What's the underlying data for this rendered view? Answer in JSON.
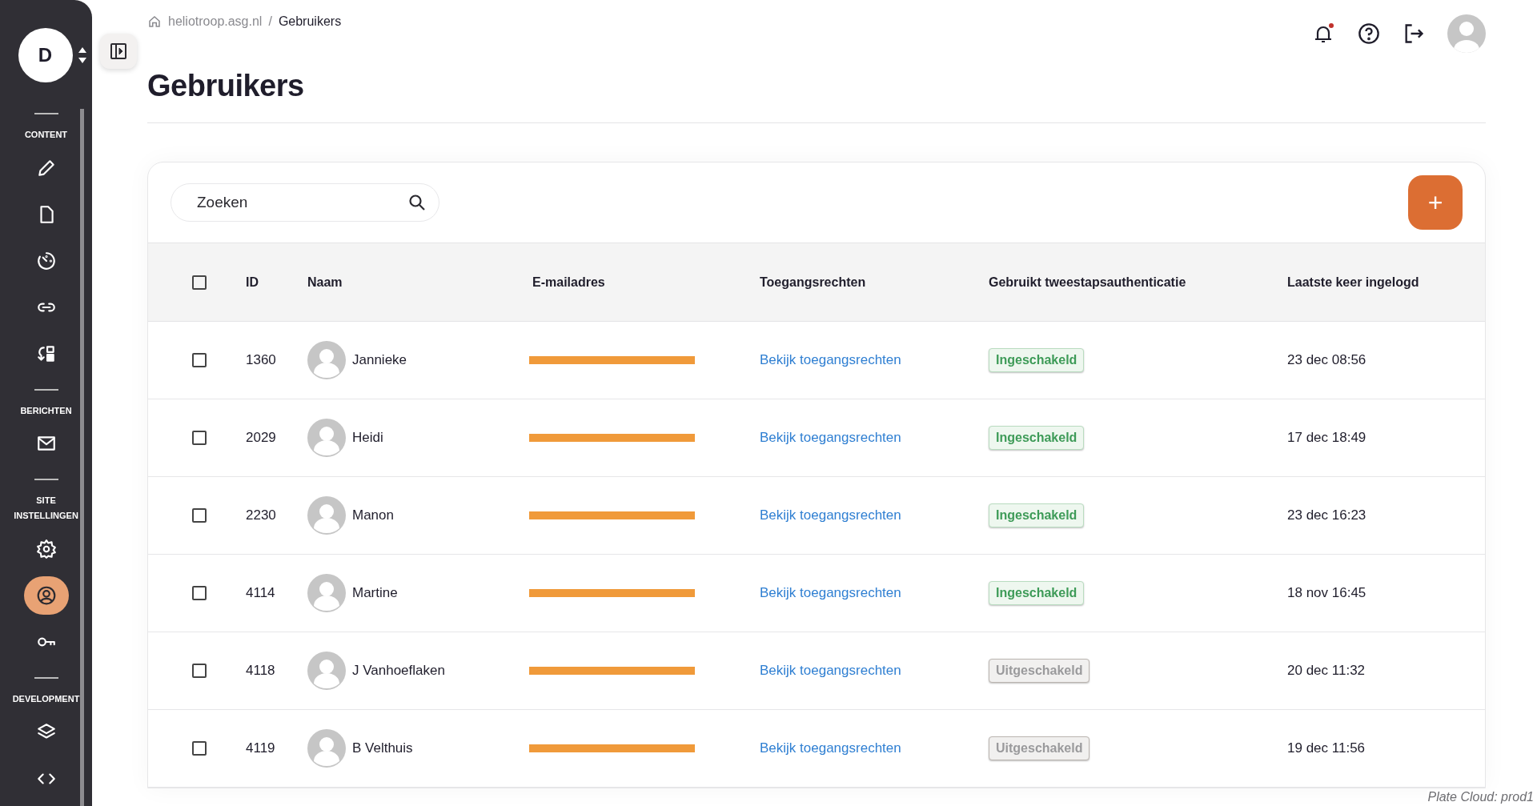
{
  "sidebar": {
    "account_initial": "D",
    "sections": [
      {
        "label": "CONTENT",
        "items": [
          {
            "selected": false
          },
          {
            "selected": false
          },
          {
            "selected": false
          },
          {
            "selected": false
          },
          {
            "selected": false
          }
        ]
      },
      {
        "label": "BERICHTEN",
        "items": [
          {
            "selected": false
          }
        ]
      },
      {
        "label": "SITE INSTELLINGEN",
        "items": [
          {
            "selected": false
          },
          {
            "selected": true
          },
          {
            "selected": false
          }
        ]
      },
      {
        "label": "DEVELOPMENT",
        "items": [
          {
            "selected": false
          },
          {
            "selected": false
          }
        ]
      }
    ]
  },
  "breadcrumb": [
    "heliotroop.asg.nl",
    "Gebruikers"
  ],
  "breadcrumb_separator": "/",
  "header": {
    "notification_unread": true
  },
  "title": "Gebruikers",
  "search": {
    "placeholder": "Zoeken"
  },
  "add_button": "+",
  "table": {
    "select_all_checked": false,
    "columns": [
      "ID",
      "Naam",
      "E-mailadres",
      "Toegangsrechten",
      "Gebruikt tweestapsauthenticatie",
      "Laatste keer ingelogd"
    ],
    "rows": [
      {
        "checked": false,
        "id": "1360",
        "name": "Jannieke",
        "access": "Bekijk toegangsrechten",
        "two_factor": "Ingeschakeld",
        "enabled": true,
        "last_login": "23 dec 08:56"
      },
      {
        "checked": false,
        "id": "2029",
        "name": "Heidi",
        "access": "Bekijk toegangsrechten",
        "two_factor": "Ingeschakeld",
        "enabled": true,
        "last_login": "17 dec 18:49"
      },
      {
        "checked": false,
        "id": "2230",
        "name": "Manon",
        "access": "Bekijk toegangsrechten",
        "two_factor": "Ingeschakeld",
        "enabled": true,
        "last_login": "23 dec 16:23"
      },
      {
        "checked": false,
        "id": "4114",
        "name": "Martine",
        "access": "Bekijk toegangsrechten",
        "two_factor": "Ingeschakeld",
        "enabled": true,
        "last_login": "18 nov 16:45"
      },
      {
        "checked": false,
        "id": "4118",
        "name": "J Vanhoeflaken",
        "access": "Bekijk toegangsrechten",
        "two_factor": "Uitgeschakeld",
        "enabled": false,
        "last_login": "20 dec 11:32"
      },
      {
        "checked": false,
        "id": "4119",
        "name": "B Velthuis",
        "access": "Bekijk toegangsrechten",
        "two_factor": "Uitgeschakeld",
        "enabled": false,
        "last_login": "19 dec 11:56"
      }
    ]
  },
  "footer": "Plate Cloud: prod1"
}
